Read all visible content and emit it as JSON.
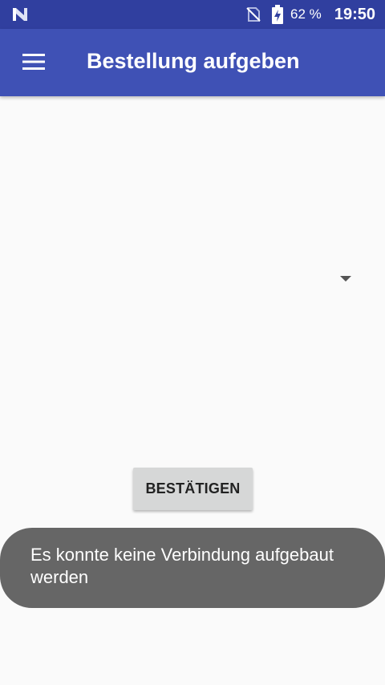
{
  "status_bar": {
    "battery_percent": "62 %",
    "time": "19:50",
    "icons": [
      "n-logo-icon",
      "no-sim-icon",
      "battery-charging-icon"
    ]
  },
  "app_bar": {
    "title": "Bestellung aufgeben",
    "menu_icon": "hamburger-menu-icon"
  },
  "spinner": {
    "icon": "dropdown-arrow-icon"
  },
  "actions": {
    "confirm_label": "BESTÄTIGEN"
  },
  "toast": {
    "message": "Es konnte keine Verbindung aufgebaut werden"
  },
  "colors": {
    "status_bar": "#303f9f",
    "app_bar": "#3f51b5",
    "background": "#fafafa",
    "button": "#d6d7d7",
    "toast": "#666666"
  }
}
